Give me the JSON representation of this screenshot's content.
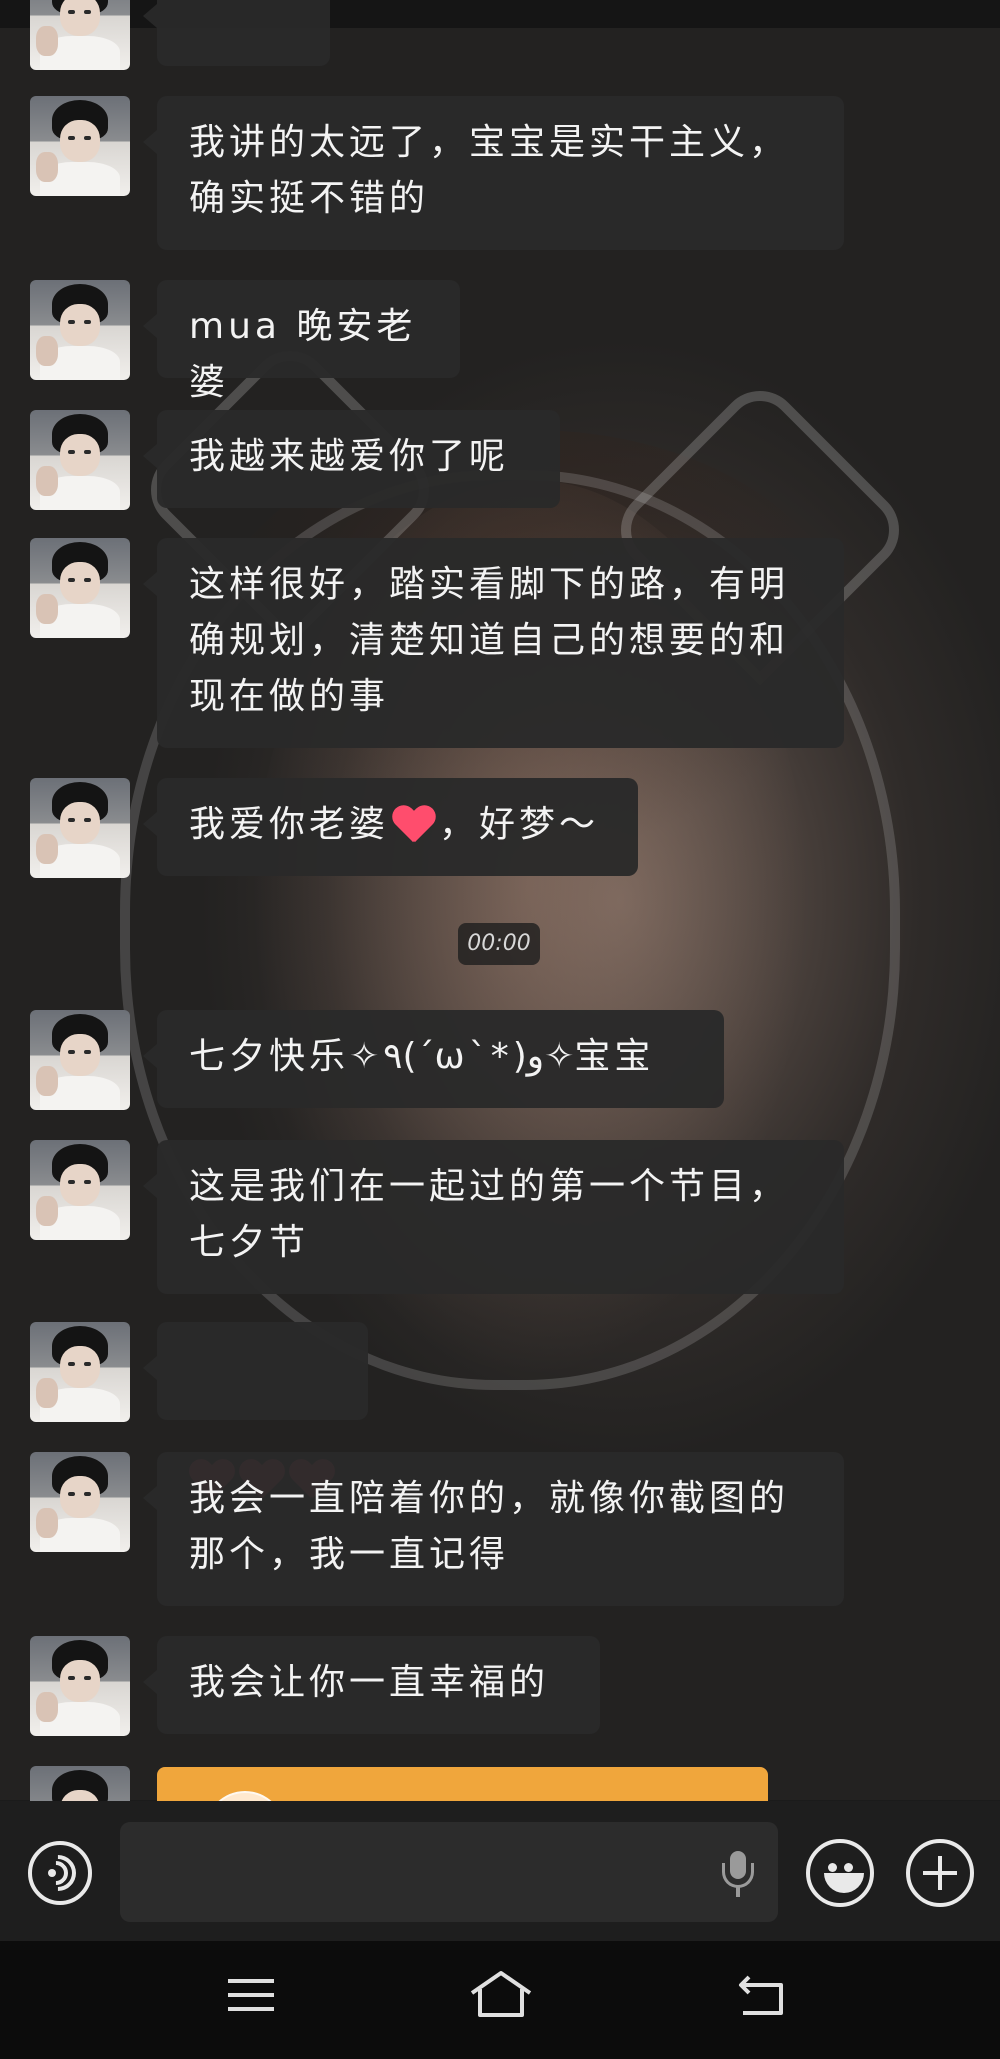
{
  "messages": [
    {
      "text": "我讲的太远了，宝宝是实干主义，\n确实挺不错的"
    },
    {
      "text": "mua 晚安老婆"
    },
    {
      "text": "我越来越爱你了呢"
    },
    {
      "text": "这样很好，踏实看脚下的路，有明\n确规划，清楚知道自己的想要的和\n现在做的事"
    },
    {
      "text_before": "我爱你老婆",
      "text_after": "，好梦～"
    },
    {
      "text": "七夕快乐✧٩(ˊωˋ*)و✧宝宝"
    },
    {
      "text": "这是我们在一起过的第一个节目，\n七夕节"
    },
    {
      "hearts": 3
    },
    {
      "text": "我会一直陪着你的，就像你截图的\n那个，我一直记得"
    },
    {
      "text": "我会让你一直幸福的"
    }
  ],
  "voice_message": {
    "duration": "00:00"
  },
  "input": {
    "value": "",
    "placeholder": ""
  },
  "icons": {
    "voice": "voice-icon",
    "mic": "mic-icon",
    "emoji": "emoji-icon",
    "plus": "plus-icon",
    "menu": "menu-icon",
    "home": "home-icon",
    "back": "back-icon"
  },
  "colors": {
    "bubble": "#2a2a2a",
    "heart": "#ff4d6d",
    "card": "#f0a63c"
  }
}
